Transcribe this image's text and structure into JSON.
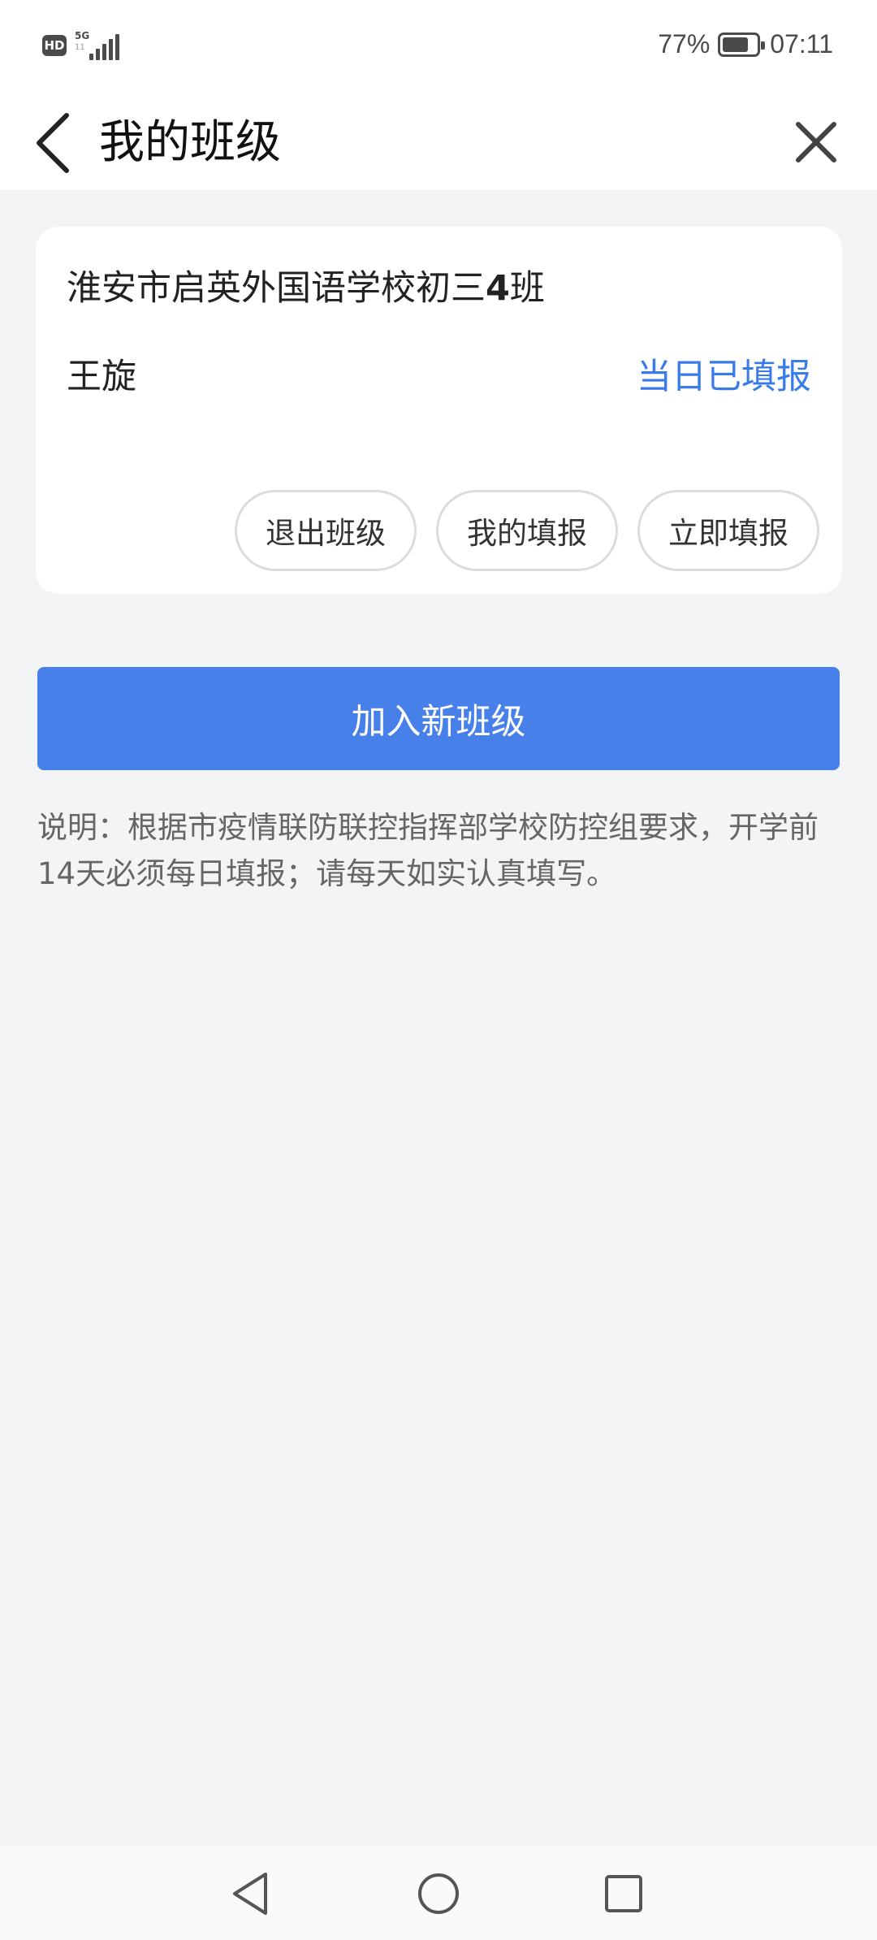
{
  "status_bar": {
    "hd_label": "HD",
    "network_label": "5G",
    "network_sub": "11",
    "battery_percent": "77%",
    "battery_level": 0.77,
    "time": "07:11"
  },
  "header": {
    "title": "我的班级",
    "back_icon": "chevron-left-icon",
    "close_icon": "close-icon"
  },
  "class_card": {
    "class_name_prefix": "淮安市启英外国语学校初三",
    "class_number": "4",
    "class_name_suffix": "班",
    "student_name": "王旋",
    "report_status": "当日已填报",
    "status_color": "#3a7bea",
    "actions": {
      "leave": "退出班级",
      "my_reports": "我的填报",
      "report_now": "立即填报"
    }
  },
  "join_button": {
    "label": "加入新班级",
    "color": "#4880ea"
  },
  "notice": "说明：根据市疫情联防联控指挥部学校防控组要求，开学前14天必须每日填报；请每天如实认真填写。",
  "nav_bar": {
    "back_icon": "triangle-back-icon",
    "home_icon": "circle-home-icon",
    "recents_icon": "square-recents-icon"
  }
}
